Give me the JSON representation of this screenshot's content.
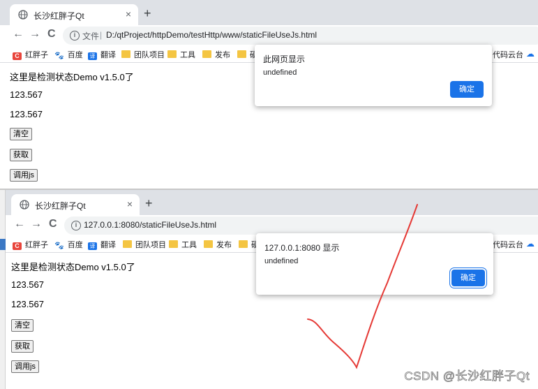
{
  "shot1": {
    "tab": {
      "title": "长沙红胖子Qt",
      "close": "×"
    },
    "new_tab": "+",
    "nav": {
      "back": "←",
      "forward": "→",
      "reload": "C"
    },
    "address": {
      "info_glyph": "i",
      "file_label": "文件",
      "separator": "|",
      "url": "D:/qtProject/httpDemo/testHttp/www/staticFileUseJs.html"
    },
    "bookmarks": [
      "红胖子",
      "百度",
      "翻译",
      "团队项目",
      "工具",
      "发布",
      "硬"
    ],
    "bookmark_right": "代码云台",
    "page": {
      "heading": "这里是检测状态Demo v1.5.0了",
      "line1": "123.567",
      "line2": "123.567",
      "clear_button": "清空",
      "get_button": "获取",
      "call_js_button": "调用js"
    },
    "dialog": {
      "title": "此网页显示",
      "message": "undefined",
      "ok": "确定"
    }
  },
  "shot2": {
    "tab": {
      "title": "长沙红胖子Qt",
      "close": "×"
    },
    "new_tab": "+",
    "nav": {
      "back": "←",
      "forward": "→",
      "reload": "C"
    },
    "address": {
      "info_glyph": "i",
      "url": "127.0.0.1:8080/staticFileUseJs.html"
    },
    "bookmarks": [
      "红胖子",
      "百度",
      "翻译",
      "团队项目",
      "工具",
      "发布",
      "硬"
    ],
    "bookmark_right": "代码云台",
    "page": {
      "heading": "这里是检测状态Demo v1.5.0了",
      "line1": "123.567",
      "line2": "123.567",
      "clear_button": "清空",
      "get_button": "获取",
      "call_js_button": "调用js"
    },
    "dialog": {
      "title": "127.0.0.1:8080 显示",
      "message": "undefined",
      "ok": "确定"
    }
  },
  "bookmark_icons": {
    "c": "C",
    "translate": "译",
    "paw": "🐾",
    "cloud": "☁"
  },
  "watermark": "CSDN @长沙红胖子Qt",
  "colors": {
    "accent": "#1a73e8",
    "check_stroke": "#e53935"
  }
}
